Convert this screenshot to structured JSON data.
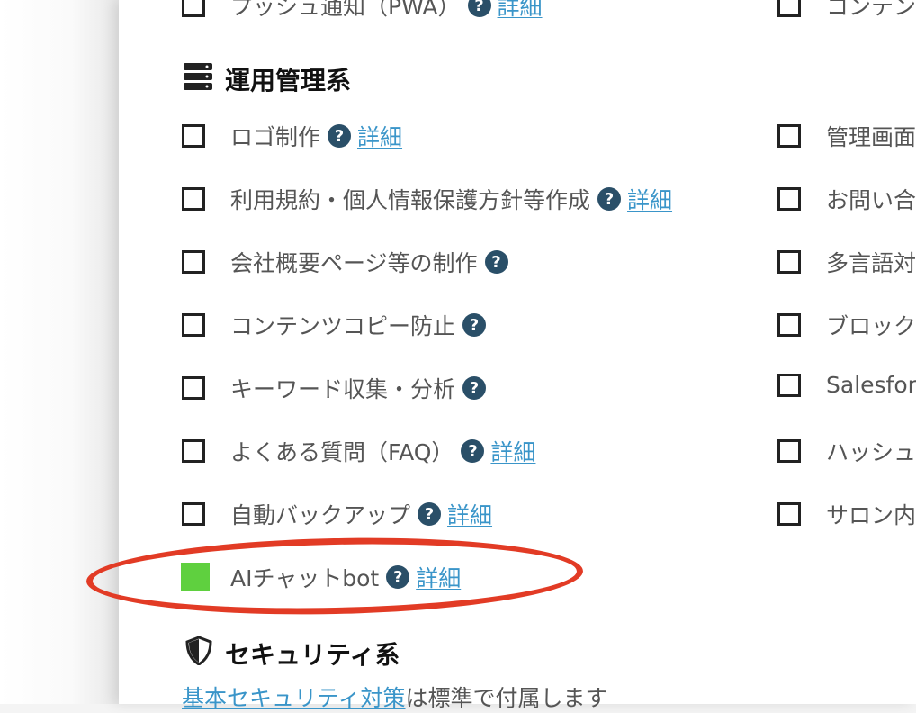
{
  "top_items": {
    "left_label": "プッシュ通知（PWA）",
    "left_detail": "詳細",
    "right_label": "コンテン"
  },
  "ops_section": {
    "title": "運用管理系",
    "icon": "server-icon"
  },
  "left_items": [
    {
      "label": "ロゴ制作",
      "detail": "詳細"
    },
    {
      "label": "利用規約・個人情報保護方針等作成",
      "detail": "詳細"
    },
    {
      "label": "会社概要ページ等の制作",
      "detail": ""
    },
    {
      "label": "コンテンツコピー防止",
      "detail": ""
    },
    {
      "label": "キーワード収集・分析",
      "detail": ""
    },
    {
      "label": "よくある質問（FAQ）",
      "detail": "詳細"
    },
    {
      "label": "自動バックアップ",
      "detail": "詳細"
    },
    {
      "label": "AIチャットbot",
      "detail": "詳細",
      "checked": true
    }
  ],
  "right_items": [
    {
      "label": "管理画面"
    },
    {
      "label": "お問い合"
    },
    {
      "label": "多言語対"
    },
    {
      "label": "ブロック"
    },
    {
      "label": "Salesforc"
    },
    {
      "label": "ハッシュ"
    },
    {
      "label": "サロン内"
    }
  ],
  "security_section": {
    "title": "セキュリティ系",
    "icon": "shield-icon",
    "link_text": "基本セキュリティ対策",
    "text_after": "は標準で付属します"
  },
  "help_glyph": "?",
  "colors": {
    "checked_box": "#5fd03f",
    "help_bg": "#2a4f68",
    "link": "#3a95c9",
    "highlight_ellipse": "#e23b25"
  }
}
